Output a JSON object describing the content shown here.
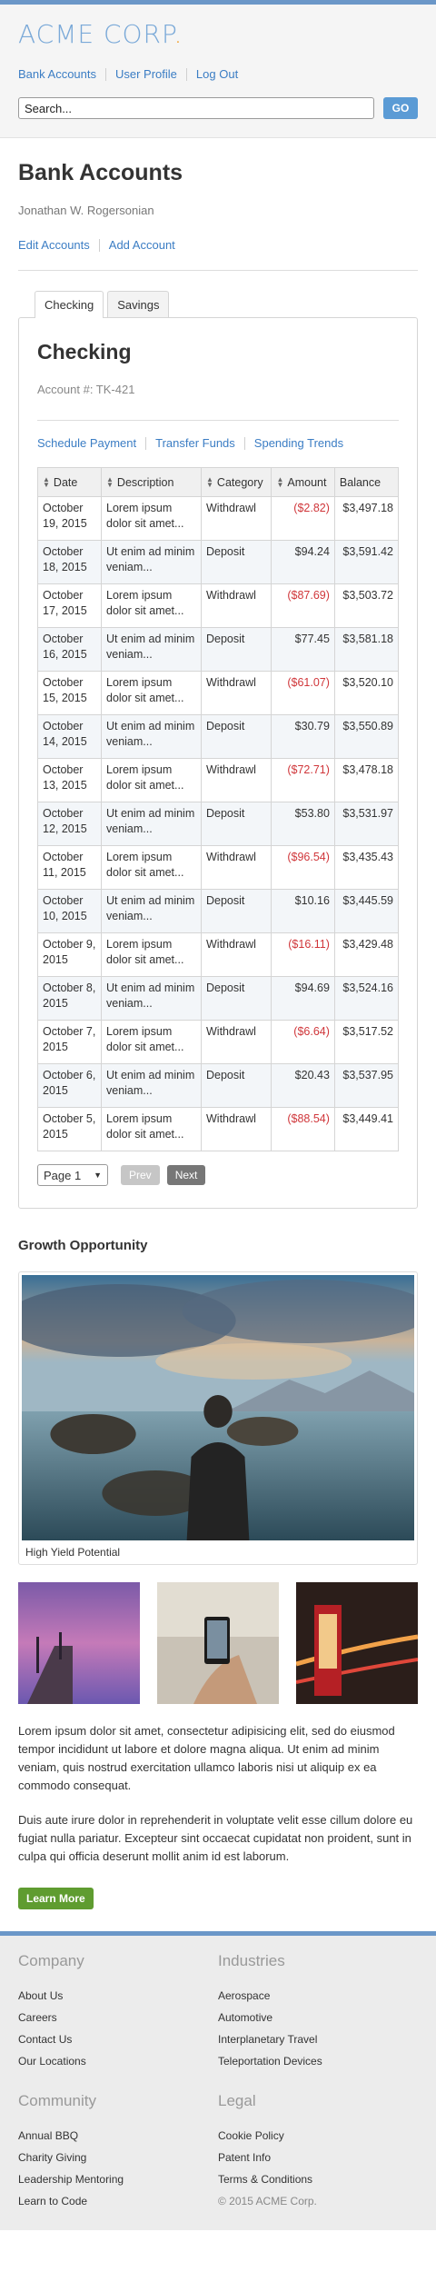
{
  "brand": {
    "name": "ACME CORP",
    "dot": "."
  },
  "topnav": [
    "Bank Accounts",
    "User Profile",
    "Log Out"
  ],
  "search": {
    "placeholder": "Search...",
    "go_label": "GO"
  },
  "page": {
    "title": "Bank Accounts",
    "owner": "Jonathan W. Rogersonian",
    "actions": [
      "Edit Accounts",
      "Add Account"
    ]
  },
  "tabs": [
    {
      "label": "Checking",
      "active": true
    },
    {
      "label": "Savings",
      "active": false
    }
  ],
  "account": {
    "title": "Checking",
    "number": "Account #: TK-421",
    "links": [
      "Schedule Payment",
      "Transfer Funds",
      "Spending Trends"
    ]
  },
  "table": {
    "headers": [
      "Date",
      "Description",
      "Category",
      "Amount",
      "Balance"
    ],
    "rows": [
      {
        "date": "October 19, 2015",
        "desc": "Lorem ipsum dolor sit amet...",
        "cat": "Withdrawl",
        "amount": "($2.82)",
        "neg": true,
        "balance": "$3,497.18"
      },
      {
        "date": "October 18, 2015",
        "desc": "Ut enim ad minim veniam...",
        "cat": "Deposit",
        "amount": "$94.24",
        "neg": false,
        "balance": "$3,591.42"
      },
      {
        "date": "October 17, 2015",
        "desc": "Lorem ipsum dolor sit amet...",
        "cat": "Withdrawl",
        "amount": "($87.69)",
        "neg": true,
        "balance": "$3,503.72"
      },
      {
        "date": "October 16, 2015",
        "desc": "Ut enim ad minim veniam...",
        "cat": "Deposit",
        "amount": "$77.45",
        "neg": false,
        "balance": "$3,581.18"
      },
      {
        "date": "October 15, 2015",
        "desc": "Lorem ipsum dolor sit amet...",
        "cat": "Withdrawl",
        "amount": "($61.07)",
        "neg": true,
        "balance": "$3,520.10"
      },
      {
        "date": "October 14, 2015",
        "desc": "Ut enim ad minim veniam...",
        "cat": "Deposit",
        "amount": "$30.79",
        "neg": false,
        "balance": "$3,550.89"
      },
      {
        "date": "October 13, 2015",
        "desc": "Lorem ipsum dolor sit amet...",
        "cat": "Withdrawl",
        "amount": "($72.71)",
        "neg": true,
        "balance": "$3,478.18"
      },
      {
        "date": "October 12, 2015",
        "desc": "Ut enim ad minim veniam...",
        "cat": "Deposit",
        "amount": "$53.80",
        "neg": false,
        "balance": "$3,531.97"
      },
      {
        "date": "October 11, 2015",
        "desc": "Lorem ipsum dolor sit amet...",
        "cat": "Withdrawl",
        "amount": "($96.54)",
        "neg": true,
        "balance": "$3,435.43"
      },
      {
        "date": "October 10, 2015",
        "desc": "Ut enim ad minim veniam...",
        "cat": "Deposit",
        "amount": "$10.16",
        "neg": false,
        "balance": "$3,445.59"
      },
      {
        "date": "October 9, 2015",
        "desc": "Lorem ipsum dolor sit amet...",
        "cat": "Withdrawl",
        "amount": "($16.11)",
        "neg": true,
        "balance": "$3,429.48"
      },
      {
        "date": "October 8, 2015",
        "desc": "Ut enim ad minim veniam...",
        "cat": "Deposit",
        "amount": "$94.69",
        "neg": false,
        "balance": "$3,524.16"
      },
      {
        "date": "October 7, 2015",
        "desc": "Lorem ipsum dolor sit amet...",
        "cat": "Withdrawl",
        "amount": "($6.64)",
        "neg": true,
        "balance": "$3,517.52"
      },
      {
        "date": "October 6, 2015",
        "desc": "Ut enim ad minim veniam...",
        "cat": "Deposit",
        "amount": "$20.43",
        "neg": false,
        "balance": "$3,537.95"
      },
      {
        "date": "October 5, 2015",
        "desc": "Lorem ipsum dolor sit amet...",
        "cat": "Withdrawl",
        "amount": "($88.54)",
        "neg": true,
        "balance": "$3,449.41"
      }
    ]
  },
  "pager": {
    "page_label": "Page 1",
    "prev_label": "Prev",
    "next_label": "Next"
  },
  "growth": {
    "title": "Growth Opportunity",
    "caption": "High Yield Potential",
    "para1": "Lorem ipsum dolor sit amet, consectetur adipisicing elit, sed do eiusmod tempor incididunt ut labore et dolore magna aliqua. Ut enim ad minim veniam, quis nostrud exercitation ullamco laboris nisi ut aliquip ex ea commodo consequat.",
    "para2": "Duis aute irure dolor in reprehenderit in voluptate velit esse cillum dolore eu fugiat nulla pariatur. Excepteur sint occaecat cupidatat non proident, sunt in culpa qui officia deserunt mollit anim id est laborum.",
    "button_label": "Learn More"
  },
  "footer": {
    "company": {
      "title": "Company",
      "links": [
        "About Us",
        "Careers",
        "Contact Us",
        "Our Locations"
      ]
    },
    "industries": {
      "title": "Industries",
      "links": [
        "Aerospace",
        "Automotive",
        "Interplanetary Travel",
        "Teleportation Devices"
      ]
    },
    "community": {
      "title": "Community",
      "links": [
        "Annual BBQ",
        "Charity Giving",
        "Leadership Mentoring",
        "Learn to Code"
      ]
    },
    "legal": {
      "title": "Legal",
      "links": [
        "Cookie Policy",
        "Patent Info",
        "Terms & Conditions"
      ]
    },
    "copyright": "© 2015 ACME Corp."
  },
  "colors": {
    "accent": "#6b97c8",
    "link": "#3b7dc4",
    "negative": "#d0363a",
    "go_button": "#5b9bd5",
    "learn_button": "#5f9c30",
    "logo_dot": "#f29b1f"
  }
}
